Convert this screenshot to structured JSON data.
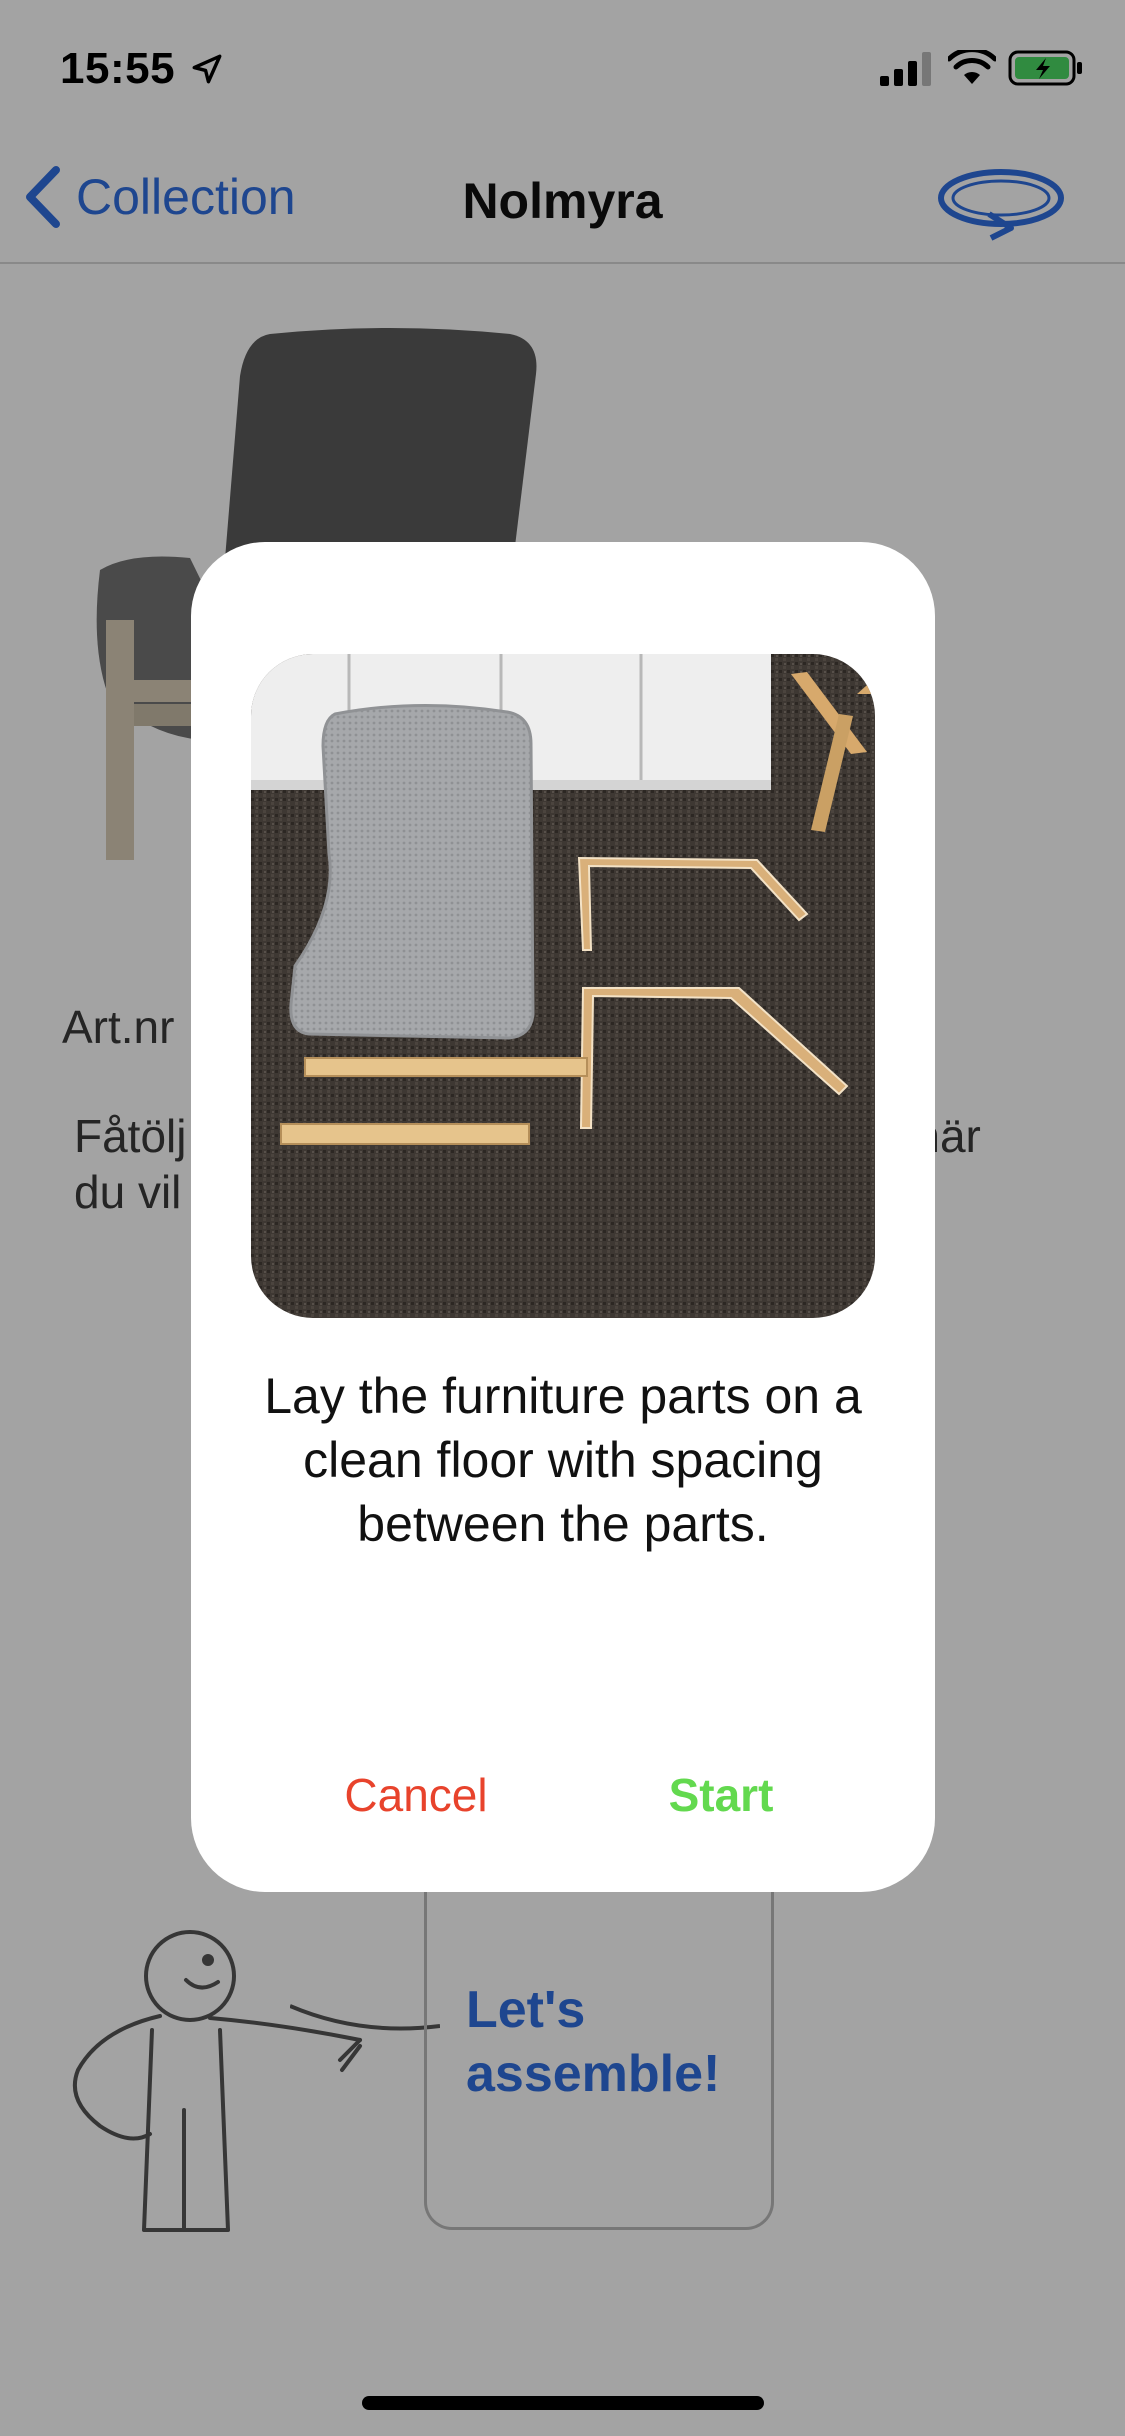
{
  "status_bar": {
    "time": "15:55",
    "location_icon": "location-arrow-icon",
    "signal_icon": "cellular-signal-icon",
    "wifi_icon": "wifi-icon",
    "battery_icon": "battery-charging-icon",
    "battery_color": "#4cd964"
  },
  "nav": {
    "back_label": "Collection",
    "title": "Nolmyra",
    "back_icon": "chevron-left-icon",
    "rotate_icon": "rotate-3d-icon",
    "accent_color": "#2f6ee0"
  },
  "background": {
    "art_number": "Art.nr",
    "description_left": "Fåtölj",
    "description_left_line2": "du vil",
    "description_right": "a när",
    "speech_text": "Let's assemble!"
  },
  "modal": {
    "photo_alt": "furniture-parts-photo",
    "message": "Lay the furniture parts on a clean floor with spacing between the parts.",
    "cancel_label": "Cancel",
    "start_label": "Start",
    "cancel_color": "#e8432c",
    "start_color": "#63d94f"
  }
}
